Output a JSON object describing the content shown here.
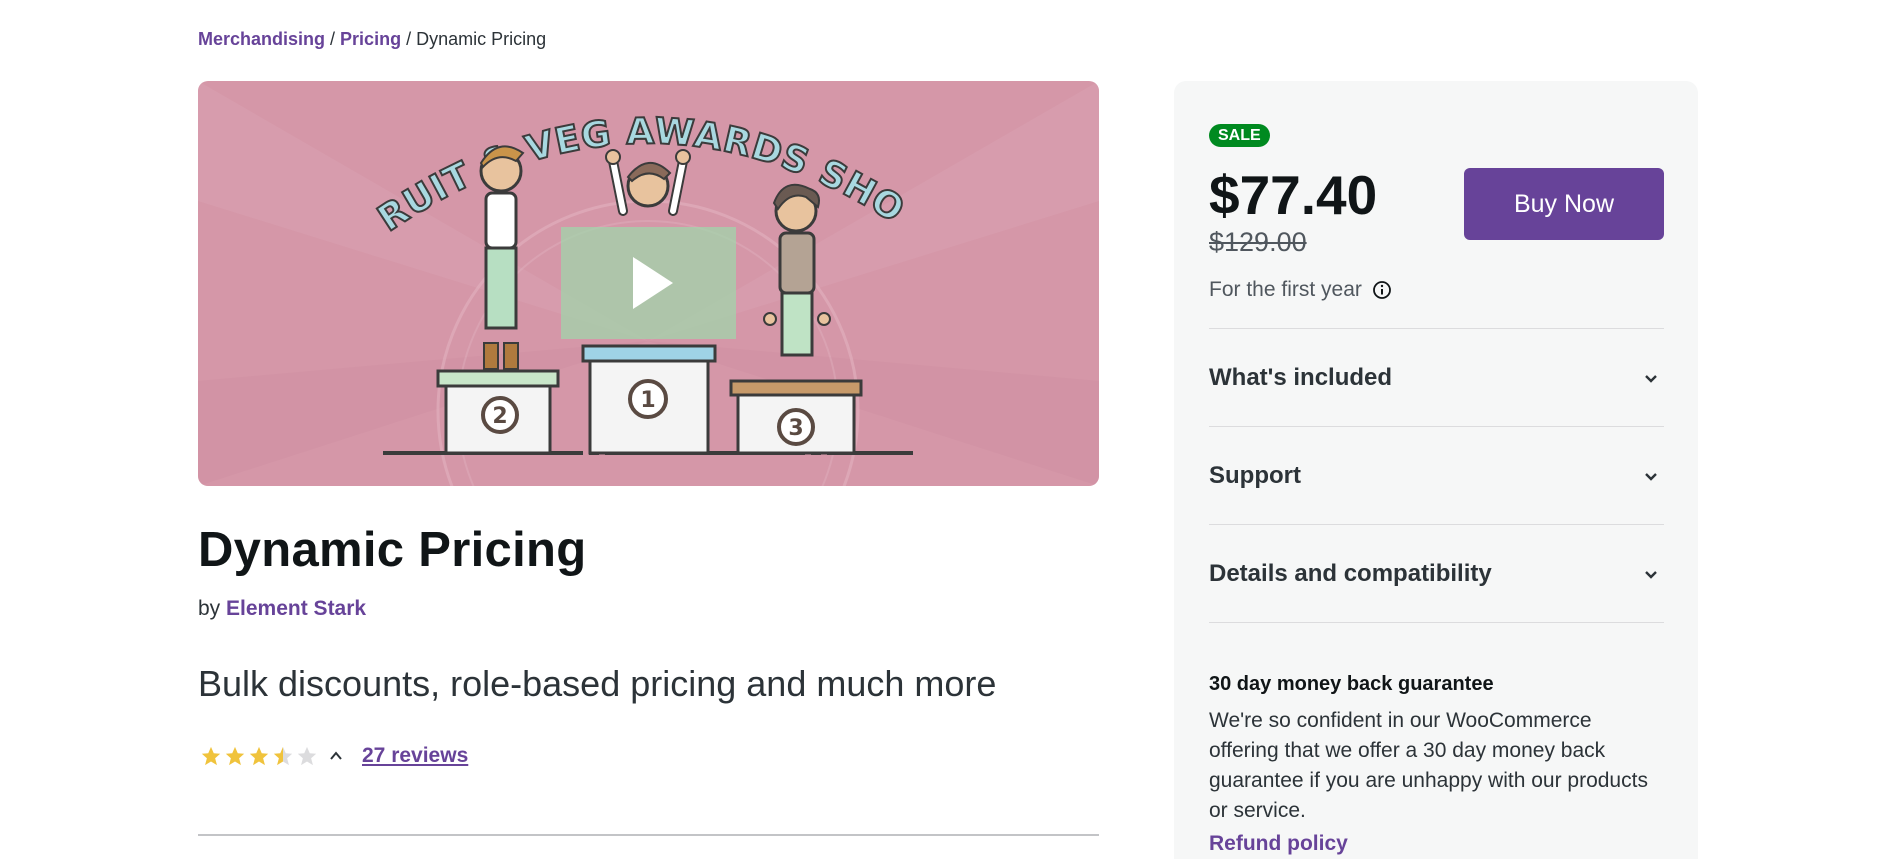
{
  "breadcrumb": {
    "items": [
      "Merchandising",
      "Pricing"
    ],
    "separator": "/",
    "current": "Dynamic Pricing"
  },
  "hero": {
    "image_text": "FRUIT & VEG AWARDS SHOW",
    "play_icon": "play-icon"
  },
  "product": {
    "title": "Dynamic Pricing",
    "by_label": "by",
    "vendor": "Element Stark",
    "tagline": "Bulk discounts, role-based pricing and much more",
    "rating": 3.5,
    "rating_max": 5,
    "reviews_label": "27 reviews"
  },
  "purchase": {
    "badge": "SALE",
    "price": "$77.40",
    "old_price": "$129.00",
    "term": "For the first year",
    "buy_label": "Buy Now"
  },
  "accordion": [
    {
      "label": "What's included"
    },
    {
      "label": "Support"
    },
    {
      "label": "Details and compatibility"
    }
  ],
  "guarantee": {
    "title": "30 day money back guarantee",
    "text": "We're so confident in our WooCommerce offering that we offer a 30 day money back guarantee if you are unhappy with our products or service.",
    "link": "Refund policy"
  },
  "colors": {
    "accent": "#674399",
    "sale": "#008a20",
    "star": "#f0c33c",
    "hero_bg": "#d597a8"
  }
}
